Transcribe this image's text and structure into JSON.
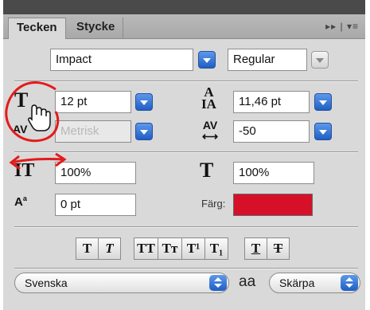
{
  "tabs": [
    {
      "label": "Tecken",
      "active": true
    },
    {
      "label": "Stycke",
      "active": false
    }
  ],
  "panel_menu": "▸▸ | ▾≡",
  "font": {
    "family": "Impact",
    "style": "Regular"
  },
  "size": {
    "value": "12 pt"
  },
  "leading": {
    "value": "11,46 pt"
  },
  "kerning": {
    "value": "Metrisk",
    "disabled": true
  },
  "tracking": {
    "value": "-50"
  },
  "vertical_scale": {
    "value": "100%"
  },
  "horizontal_scale": {
    "value": "100%"
  },
  "baseline_shift": {
    "value": "0 pt"
  },
  "color": {
    "label": "Färg:",
    "value": "#d7102a"
  },
  "style_buttons": [
    {
      "label": "T",
      "name": "faux-bold"
    },
    {
      "label": "T",
      "name": "faux-italic"
    },
    {
      "label": "TT",
      "name": "all-caps"
    },
    {
      "label": "Tт",
      "name": "small-caps"
    },
    {
      "label": "T¹",
      "name": "superscript"
    },
    {
      "label": "T₁",
      "name": "subscript"
    },
    {
      "label": "T",
      "name": "underline"
    },
    {
      "label": "T",
      "name": "strikethrough"
    }
  ],
  "language": {
    "value": "Svenska"
  },
  "antialias": {
    "icon_label": "aa",
    "value": "Skärpa"
  },
  "icons": {
    "size": "font-size-icon",
    "leading": "leading-icon",
    "kerning": "kerning-icon",
    "tracking": "tracking-icon",
    "vscale": "vertical-scale-icon",
    "hscale": "horizontal-scale-icon",
    "baseline": "baseline-shift-icon",
    "cursor": "hand-cursor-icon"
  },
  "annotation_color": "#e31b1b"
}
